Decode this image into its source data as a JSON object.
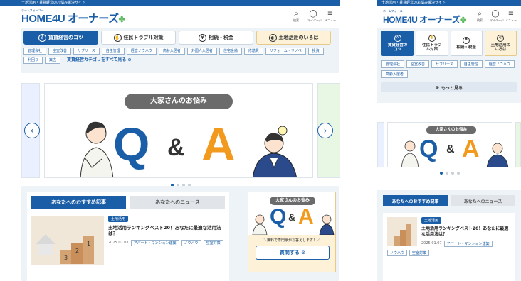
{
  "site": {
    "topbar_text": "土地活用・賃貸経営のお悩み解決サイト",
    "logo_sub": "ホームフォーユー",
    "logo_main": "HOME4U オーナーズ",
    "logo_leaf": "✤",
    "header_icons": [
      {
        "icon": "search-icon",
        "glyph": "⌕",
        "label": "検索"
      },
      {
        "icon": "user-icon",
        "glyph": "◯",
        "label": "マイページ"
      },
      {
        "icon": "menu-icon",
        "glyph": "≡",
        "label": "メニュー"
      }
    ]
  },
  "desktop": {
    "tabs": [
      {
        "label": "賃貸経営のコツ",
        "glyph": "♁"
      },
      {
        "label": "住民トラブル対策",
        "glyph": "✋"
      },
      {
        "label": "相続・税金",
        "glyph": "¥"
      },
      {
        "label": "土地活用のいろは",
        "glyph": "◐"
      }
    ],
    "chips": [
      "管理会社",
      "空室改善",
      "サブリース",
      "自主管理",
      "経営ノウハウ",
      "高齢入居者",
      "外国人入居者",
      "住宅設備",
      "修繕費",
      "リフォーム・リノベ",
      "投資",
      "利回り",
      "築古"
    ],
    "more_link": "賃貸経営カテゴリをすべて見る ⊕",
    "carousel": {
      "bubble": "大家さんのお悩み",
      "q": "Q",
      "amp": "&",
      "a": "A",
      "prev": "‹",
      "next": "›"
    },
    "rec_tabs": [
      "あなたへのおすすめ記事",
      "あなたへのニュース"
    ],
    "article": {
      "badge": "土地活用",
      "title": "土地活用ランキングベスト20！あなたに最適な活用法は？",
      "date": "2025.01.07",
      "tags": [
        "アパート・マンション建築",
        "ノウハウ",
        "空室対策"
      ]
    },
    "qa_card": {
      "bubble": "大家さんのお悩み",
      "q": "Q",
      "amp": "&",
      "a": "A",
      "caption": "＼無料で専門家がお答えします！／",
      "button": "質問する ⊙"
    }
  },
  "mobile": {
    "tabs": [
      {
        "label": "賃貸経営の\nコツ",
        "glyph": "♁"
      },
      {
        "label": "住民トラブ\nル対策",
        "glyph": "✋"
      },
      {
        "label": "相続・税金",
        "glyph": "¥"
      },
      {
        "label": "土地活用の\nいろは",
        "glyph": "◐"
      }
    ],
    "chips": [
      "管理会社",
      "空室改善",
      "サブリース",
      "自主管理",
      "経営ノウハウ",
      "高齢入居者"
    ],
    "more": "もっと見る",
    "carousel": {
      "bubble": "大家さんのお悩み",
      "q": "Q",
      "amp": "&",
      "a": "A"
    },
    "rec_tabs": [
      "あなたへのおすすめ記事",
      "あなたへのニュース"
    ],
    "article": {
      "badge": "土地活用",
      "title": "土地活用ランキングベスト20！あなたに最適な活用法は？",
      "date": "2025.01.07",
      "tags": [
        "アパート・マンション建築",
        "ノウハウ",
        "空室対策"
      ]
    }
  },
  "colors": {
    "brand": "#1a5ea8",
    "accent_orange": "#f29a1d",
    "leaf": "#5cb85c"
  }
}
